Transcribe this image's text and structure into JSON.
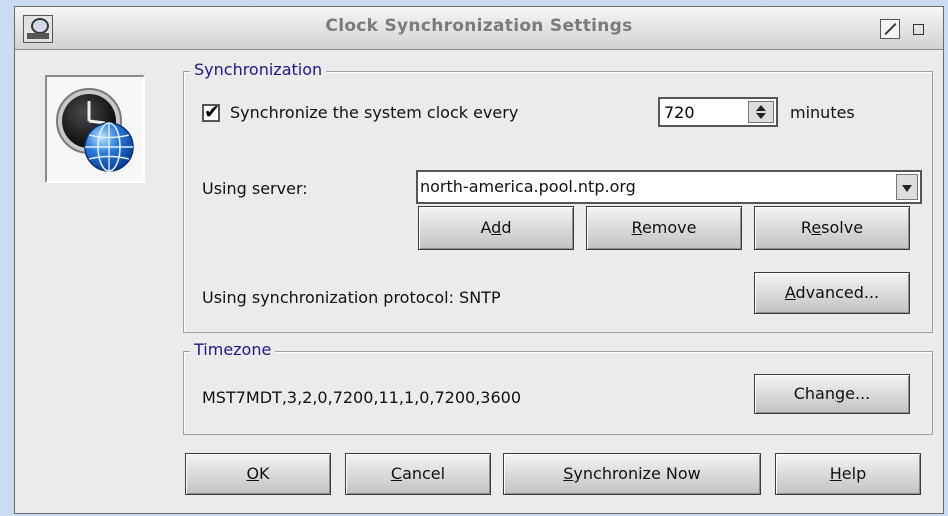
{
  "window": {
    "title": "Clock Synchronization Settings"
  },
  "sync": {
    "group_title": "Synchronization",
    "check_label": "Synchronize the system clock every",
    "checked": true,
    "interval_value": "720",
    "interval_unit": "minutes",
    "server_label": "Using server:",
    "server_value": "north-america.pool.ntp.org",
    "add": {
      "pre": "A",
      "mnemonic": "d",
      "post": "d"
    },
    "remove": {
      "pre": "",
      "mnemonic": "R",
      "post": "emove"
    },
    "resolve": {
      "pre": "R",
      "mnemonic": "e",
      "post": "solve"
    },
    "protocol_label": "Using synchronization protocol:  SNTP",
    "advanced": {
      "pre": "",
      "mnemonic": "A",
      "post": "dvanced..."
    }
  },
  "timezone": {
    "group_title": "Timezone",
    "value": "MST7MDT,3,2,0,7200,11,1,0,7200,3600",
    "change": {
      "pre": "Chan",
      "mnemonic": "g",
      "post": "e..."
    }
  },
  "footer": {
    "ok": {
      "pre": "",
      "mnemonic": "O",
      "post": "K"
    },
    "cancel": {
      "pre": "",
      "mnemonic": "C",
      "post": "ancel"
    },
    "sync_now": {
      "pre": "",
      "mnemonic": "S",
      "post": "ynchronize Now"
    },
    "help": {
      "pre": "",
      "mnemonic": "H",
      "post": "elp"
    }
  },
  "icons": {
    "system_menu": "system-menu-icon",
    "logo": "clock-globe-icon",
    "zoom": "zoom-icon",
    "iconify": "iconify-icon"
  },
  "colors": {
    "group_title": "#1a1a8a",
    "title_text": "#7b7b7b",
    "desktop": "#c9dcf2"
  }
}
